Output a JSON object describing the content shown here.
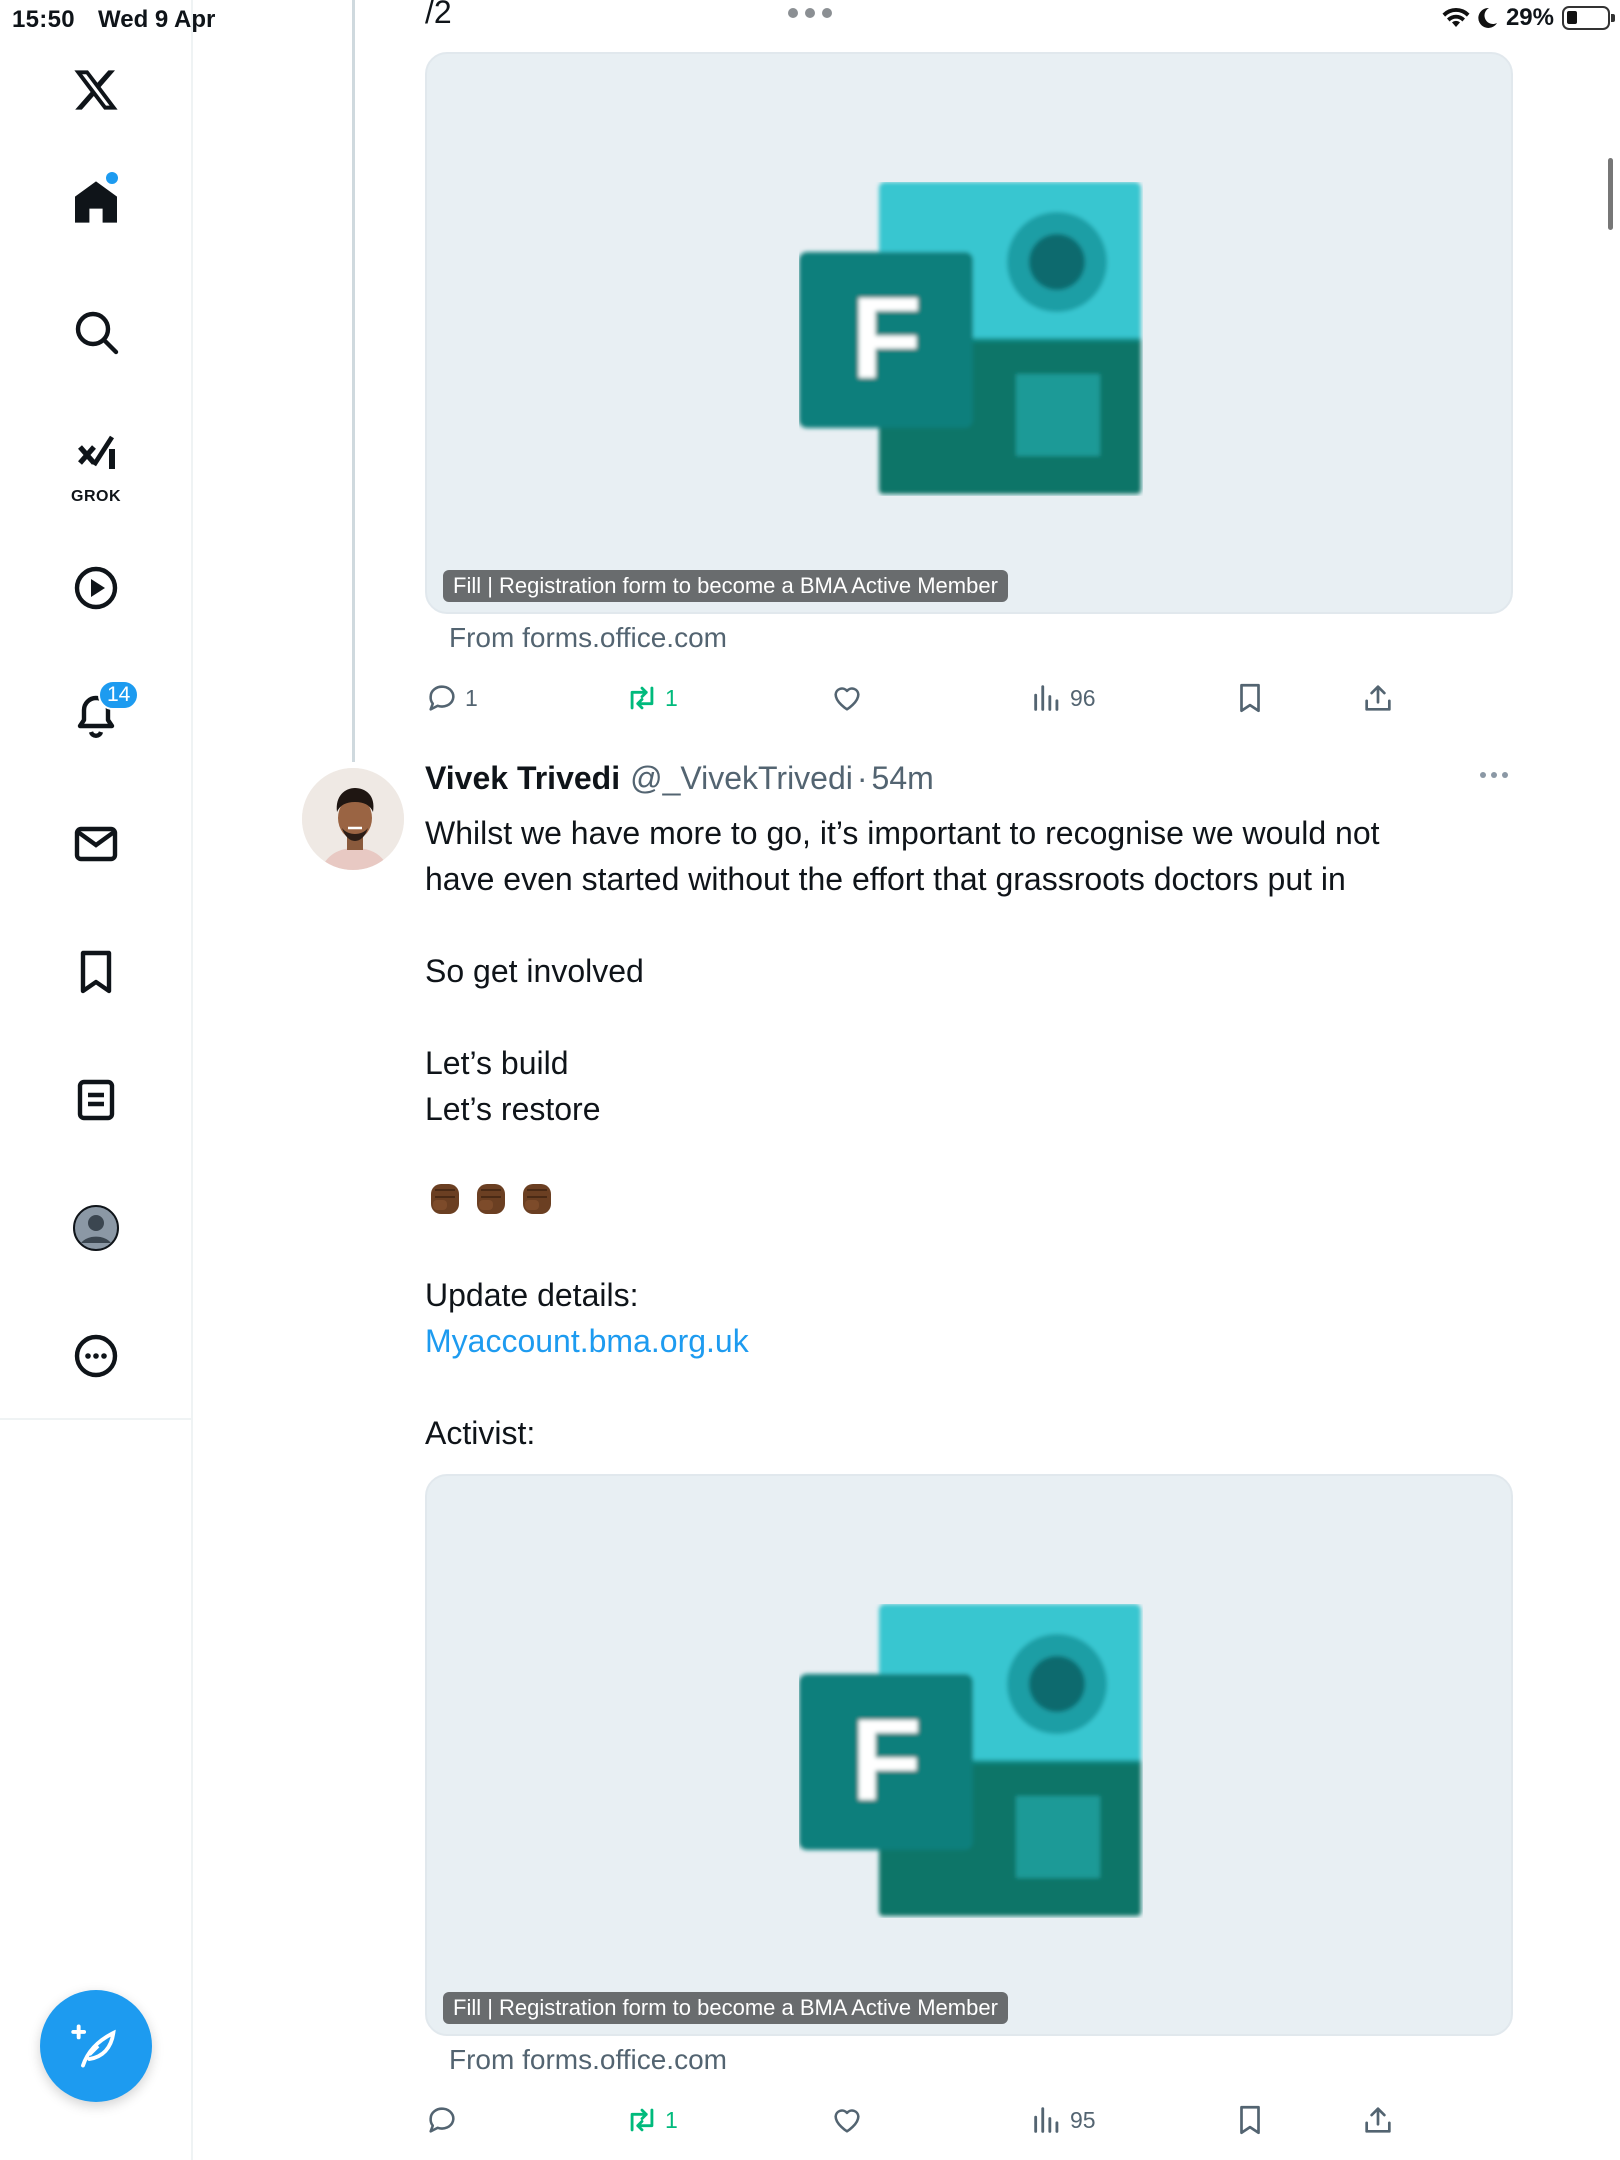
{
  "status_bar": {
    "time": "15:50",
    "date": "Wed 9 Apr",
    "battery": "29%"
  },
  "sidebar": {
    "items": [
      {
        "name": "x-logo"
      },
      {
        "name": "home",
        "has_dot": true
      },
      {
        "name": "search"
      },
      {
        "name": "grok",
        "label": "GROK"
      },
      {
        "name": "video"
      },
      {
        "name": "notifications",
        "badge": "14"
      },
      {
        "name": "messages"
      },
      {
        "name": "bookmarks"
      },
      {
        "name": "lists"
      },
      {
        "name": "profile"
      },
      {
        "name": "more"
      }
    ]
  },
  "thread": {
    "counter": "/2",
    "first_card": {
      "caption": "Fill | Registration form to become a BMA Active Member",
      "source": "From forms.office.com"
    },
    "first_actions": {
      "replies": "1",
      "reposts": "1",
      "views": "96"
    }
  },
  "tweet": {
    "author_name": "Vivek Trivedi",
    "handle": "@_VivekTrivedi",
    "separator": "·",
    "time": "54m",
    "line1": "Whilst we have more to go, it’s important to recognise we would not",
    "line2": "have even started without the effort that grassroots doctors put in",
    "line3": "So get involved",
    "line4": "Let’s build",
    "line5": "Let’s restore",
    "line6": "Update details:",
    "link": "Myaccount.bma.org.uk",
    "line7": "Activist:",
    "card": {
      "caption": "Fill | Registration form to become a BMA Active Member",
      "source": "From forms.office.com"
    },
    "actions": {
      "reposts": "1",
      "views": "95"
    }
  },
  "colors": {
    "accent": "#1d9bf0",
    "repost_green": "#00ba7c",
    "muted": "#536471",
    "forms_teal_dark": "#077568",
    "forms_teal_light": "#37c6d0"
  }
}
